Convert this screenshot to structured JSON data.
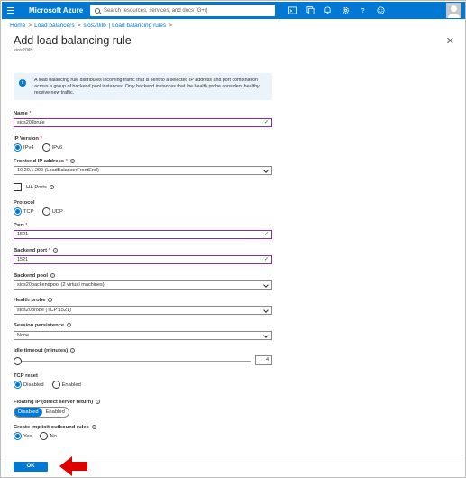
{
  "topbar": {
    "brand": "Microsoft Azure",
    "search_placeholder": "Search resources, services, and docs (G+/)",
    "icons": [
      "cloud-shell-icon",
      "directory-filter-icon",
      "notifications-icon",
      "settings-icon",
      "help-icon",
      "feedback-icon"
    ],
    "accent": "#0078d4"
  },
  "breadcrumb": [
    "Home",
    "Load balancers",
    "sios20ilb",
    "| Load balancing rules"
  ],
  "page": {
    "title": "Add load balancing rule",
    "subtitle": "sios20ilb"
  },
  "info": {
    "text": "A load balancing rule distributes incoming traffic that is sent to a selected IP address and port combination across a group of backend pool instances. Only backend instances that the health probe considers healthy receive new traffic."
  },
  "form": {
    "name_label": "Name",
    "name_value": "sios20ilbrule",
    "ip_version_label": "IP Version",
    "ip_version_options": [
      "IPv4",
      "IPv6"
    ],
    "frontend_label": "Frontend IP address",
    "frontend_value": "10.20.1.200 (LoadBalancerFrontEnd)",
    "ha_ports_label": "HA Ports",
    "protocol_label": "Protocol",
    "protocol_options": [
      "TCP",
      "UDP"
    ],
    "port_label": "Port",
    "port_value": "1521",
    "backend_port_label": "Backend port",
    "backend_port_value": "1521",
    "backend_pool_label": "Backend pool",
    "backend_pool_value": "sios20backendpool (2 virtual machines)",
    "health_probe_label": "Health probe",
    "health_probe_value": "sios20probe (TCP:1521)",
    "session_label": "Session persistence",
    "session_value": "None",
    "idle_label": "Idle timeout (minutes)",
    "idle_value": "4",
    "tcp_reset_label": "TCP reset",
    "tcp_reset_options": [
      "Disabled",
      "Enabled"
    ],
    "floating_label": "Floating IP (direct server return)",
    "floating_options": [
      "Disabled",
      "Enabled"
    ],
    "outbound_label": "Create implicit outbound rules",
    "outbound_options": [
      "Yes",
      "No"
    ]
  },
  "footer": {
    "ok_label": "OK"
  }
}
